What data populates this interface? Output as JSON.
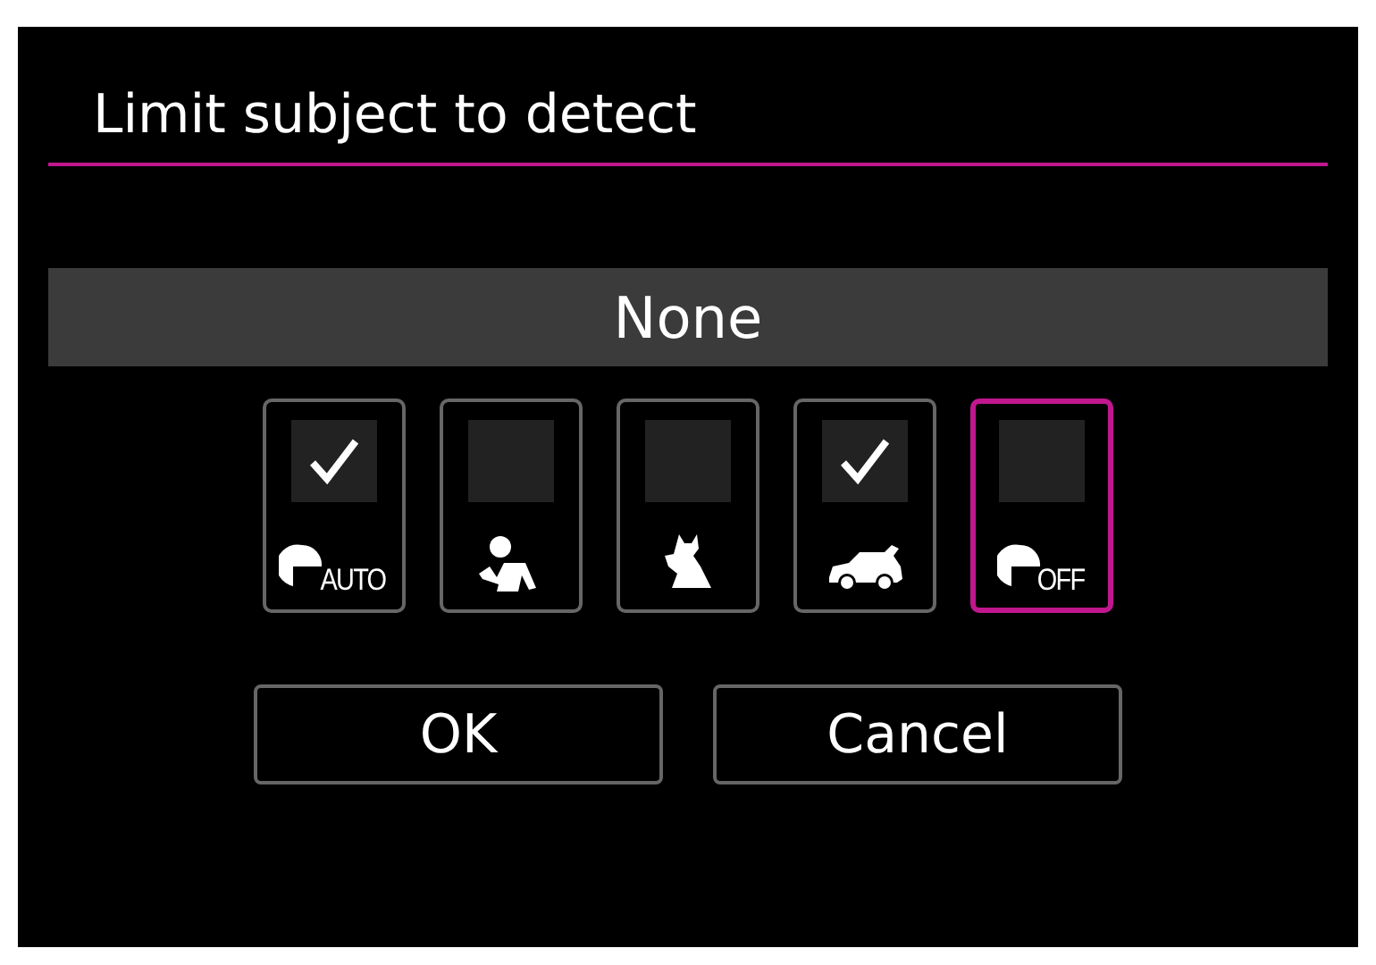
{
  "title": "Limit subject to detect",
  "current": "None",
  "subjects": [
    {
      "kind": "auto",
      "label": "AUTO",
      "checked": true,
      "selected": false
    },
    {
      "kind": "person",
      "checked": false,
      "selected": false
    },
    {
      "kind": "animal",
      "checked": false,
      "selected": false
    },
    {
      "kind": "vehicle",
      "checked": true,
      "selected": false
    },
    {
      "kind": "off",
      "label": "OFF",
      "checked": false,
      "selected": true
    }
  ],
  "buttons": [
    "OK",
    "Cancel"
  ]
}
